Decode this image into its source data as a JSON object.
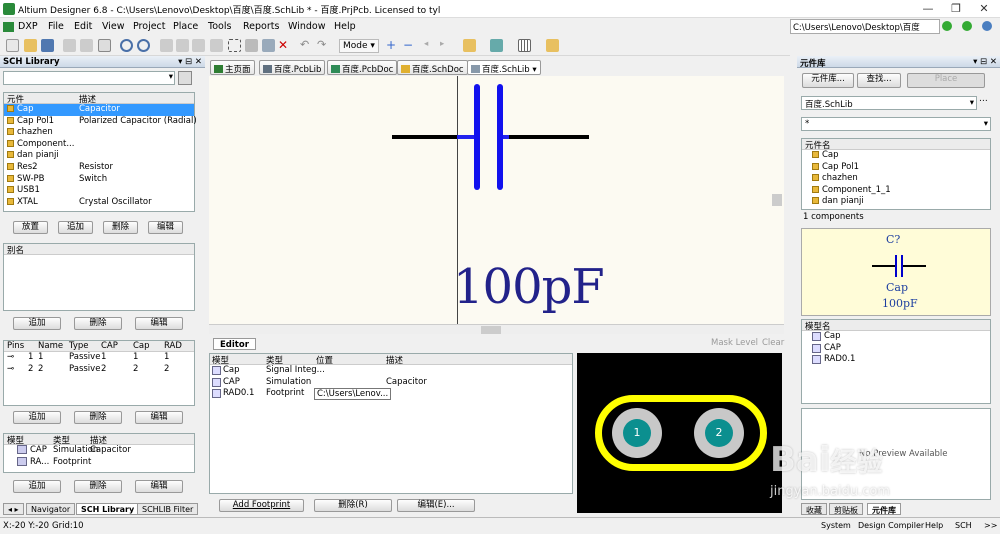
{
  "window": {
    "title": "Altium Designer 6.8 - C:\\Users\\Lenovo\\Desktop\\百度\\百度.SchLib * - 百度.PrjPcb. Licensed to tyl",
    "path": "C:\\Users\\Lenovo\\Desktop\\百度"
  },
  "menu": [
    "DXP",
    "File",
    "Edit",
    "View",
    "Project",
    "Place",
    "Tools",
    "Reports",
    "Window",
    "Help"
  ],
  "toolbar": {
    "mode_label": "Mode"
  },
  "left_panel": {
    "title": "SCH Library",
    "components_table": {
      "headers": [
        "元件",
        "描述"
      ],
      "rows": [
        {
          "name": "Cap",
          "desc": "Capacitor"
        },
        {
          "name": "Cap Pol1",
          "desc": "Polarized Capacitor (Radial)"
        },
        {
          "name": "chazhen",
          "desc": ""
        },
        {
          "name": "Component...",
          "desc": ""
        },
        {
          "name": "dan pianji",
          "desc": ""
        },
        {
          "name": "Res2",
          "desc": "Resistor"
        },
        {
          "name": "SW-PB",
          "desc": "Switch"
        },
        {
          "name": "USB1",
          "desc": ""
        },
        {
          "name": "XTAL",
          "desc": "Crystal Oscillator"
        }
      ]
    },
    "comp_buttons": [
      "放置",
      "追加",
      "删除",
      "编辑"
    ],
    "alias_header": "别名",
    "alias_buttons": [
      "追加",
      "删除",
      "编辑"
    ],
    "pins_table": {
      "headers": [
        "Pins",
        "Name",
        "Type",
        "CAP",
        "Cap",
        "RAD"
      ],
      "rows": [
        [
          "1",
          "1",
          "Passive",
          "1",
          "1",
          "1"
        ],
        [
          "2",
          "2",
          "Passive",
          "2",
          "2",
          "2"
        ]
      ]
    },
    "pins_buttons": [
      "追加",
      "删除",
      "编辑"
    ],
    "models_table": {
      "headers": [
        "模型",
        "类型",
        "描述"
      ],
      "rows": [
        {
          "name": "CAP",
          "type": "Simulation",
          "desc": "Capacitor"
        },
        {
          "name": "RA...",
          "type": "Footprint",
          "desc": ""
        }
      ]
    },
    "model_buttons": [
      "追加",
      "删除",
      "编辑"
    ],
    "bottom_tabs": [
      "Navigator",
      "SCH Library",
      "SCHLIB Filter"
    ]
  },
  "doc_tabs": [
    {
      "label": "主页面",
      "color": "#2e7d32"
    },
    {
      "label": "百度.PcbLib",
      "color": "#607080"
    },
    {
      "label": "百度.PcbDoc",
      "color": "#2e8b57"
    },
    {
      "label": "百度.SchDoc",
      "color": "#e0b030"
    },
    {
      "label": "百度.SchLib",
      "color": "#8899aa"
    }
  ],
  "schematic": {
    "value_text": "100pF"
  },
  "editor": {
    "tab_label": "Editor",
    "mask_level": "Mask Level",
    "clear": "Clear",
    "headers": [
      "模型",
      "类型",
      "位置",
      "描述"
    ],
    "rows": [
      {
        "name": "Cap",
        "type": "Signal Integ...",
        "loc": "",
        "desc": ""
      },
      {
        "name": "CAP",
        "type": "Simulation",
        "loc": "",
        "desc": "Capacitor"
      },
      {
        "name": "RAD0.1",
        "type": "Footprint",
        "loc": "C:\\Users\\Lenov...",
        "desc": ""
      }
    ],
    "buttons": [
      "Add Footprint",
      "删除(R)",
      "编辑(E)..."
    ],
    "pad_labels": [
      "1",
      "2"
    ]
  },
  "right_panel": {
    "title": "元件库",
    "btn_lib": "元件库...",
    "btn_search": "查找...",
    "btn_place": "Place",
    "library_select": "百度.SchLib",
    "filter_value": "*",
    "list_header": "元件名",
    "components": [
      "Cap",
      "Cap Pol1",
      "chazhen",
      "Component_1_1",
      "dan pianji"
    ],
    "count": "1 components",
    "preview_ref": "C?",
    "preview_name": "Cap",
    "preview_value": "100pF",
    "models_header": "模型名",
    "models": [
      "Cap",
      "CAP",
      "RAD0.1"
    ],
    "no_preview": "No Preview Available",
    "bottom_tabs": [
      "收藏",
      "剪贴板",
      "元件库"
    ]
  },
  "status": {
    "coords": "X:-20 Y:-20",
    "grid": "Grid:10",
    "buttons": [
      "System",
      "Design Compiler",
      "Help",
      "SCH",
      ">>"
    ]
  },
  "watermark": {
    "brand": "Bai",
    "brand2": "经验",
    "url": "jingyan.baidu.com"
  }
}
